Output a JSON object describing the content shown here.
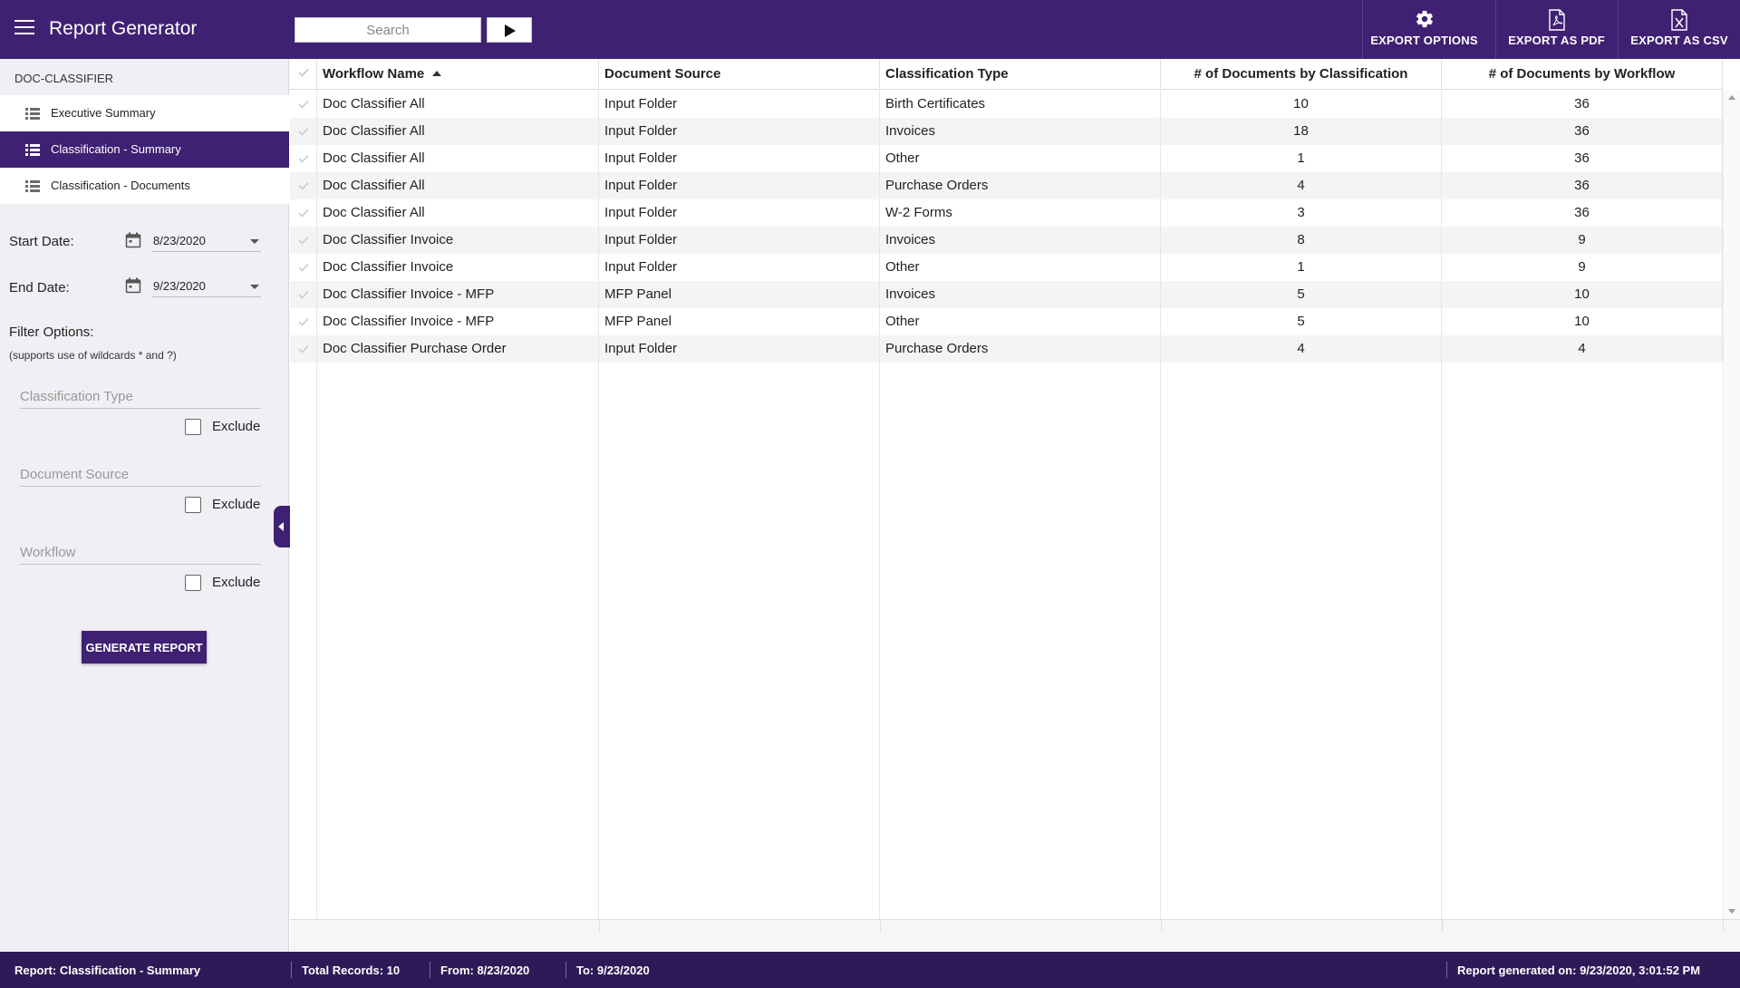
{
  "app": {
    "title": "Report Generator"
  },
  "search": {
    "placeholder": "Search"
  },
  "toolbar": {
    "export_options": "EXPORT OPTIONS",
    "export_pdf": "EXPORT AS PDF",
    "export_csv": "EXPORT AS CSV",
    "icons": [
      "gear-icon",
      "pdf-file-icon",
      "excel-file-icon"
    ]
  },
  "sidebar": {
    "heading": "DOC-CLASSIFIER",
    "items": [
      {
        "label": "Executive Summary",
        "active": false
      },
      {
        "label": "Classification - Summary",
        "active": true
      },
      {
        "label": "Classification - Documents",
        "active": false
      }
    ],
    "start_date_label": "Start Date:",
    "start_date_value": "8/23/2020",
    "end_date_label": "End Date:",
    "end_date_value": "9/23/2020",
    "filter_options_label": "Filter Options:",
    "filter_hint": "(supports use of wildcards * and ?)",
    "filters": [
      {
        "placeholder": "Classification Type",
        "exclude_label": "Exclude",
        "excluded": false
      },
      {
        "placeholder": "Document Source",
        "exclude_label": "Exclude",
        "excluded": false
      },
      {
        "placeholder": "Workflow",
        "exclude_label": "Exclude",
        "excluded": false
      }
    ],
    "generate_label": "GENERATE REPORT"
  },
  "grid": {
    "columns": [
      "Workflow Name",
      "Document Source",
      "Classification Type",
      "# of Documents by Classification",
      "# of Documents by Workflow"
    ],
    "sort": {
      "column": "Workflow Name",
      "direction": "ascending"
    },
    "rows": [
      [
        "Doc Classifier All",
        "Input Folder",
        "Birth Certificates",
        "10",
        "36"
      ],
      [
        "Doc Classifier All",
        "Input Folder",
        "Invoices",
        "18",
        "36"
      ],
      [
        "Doc Classifier All",
        "Input Folder",
        "Other",
        "1",
        "36"
      ],
      [
        "Doc Classifier All",
        "Input Folder",
        "Purchase Orders",
        "4",
        "36"
      ],
      [
        "Doc Classifier All",
        "Input Folder",
        "W-2 Forms",
        "3",
        "36"
      ],
      [
        "Doc Classifier Invoice",
        "Input Folder",
        "Invoices",
        "8",
        "9"
      ],
      [
        "Doc Classifier Invoice",
        "Input Folder",
        "Other",
        "1",
        "9"
      ],
      [
        "Doc Classifier Invoice - MFP",
        "MFP Panel",
        "Invoices",
        "5",
        "10"
      ],
      [
        "Doc Classifier Invoice - MFP",
        "MFP Panel",
        "Other",
        "5",
        "10"
      ],
      [
        "Doc Classifier Purchase Order",
        "Input Folder",
        "Purchase Orders",
        "4",
        "4"
      ]
    ]
  },
  "status": {
    "report": "Report: Classification - Summary",
    "total": "Total Records: 10",
    "from": "From: 8/23/2020",
    "to": "To: 9/23/2020",
    "generated": "Report generated on: 9/23/2020, 3:01:52 PM"
  },
  "colors": {
    "brand": "#3f2173",
    "status_bar": "#2e1a57",
    "sidebar_bg": "#f0eff4"
  }
}
